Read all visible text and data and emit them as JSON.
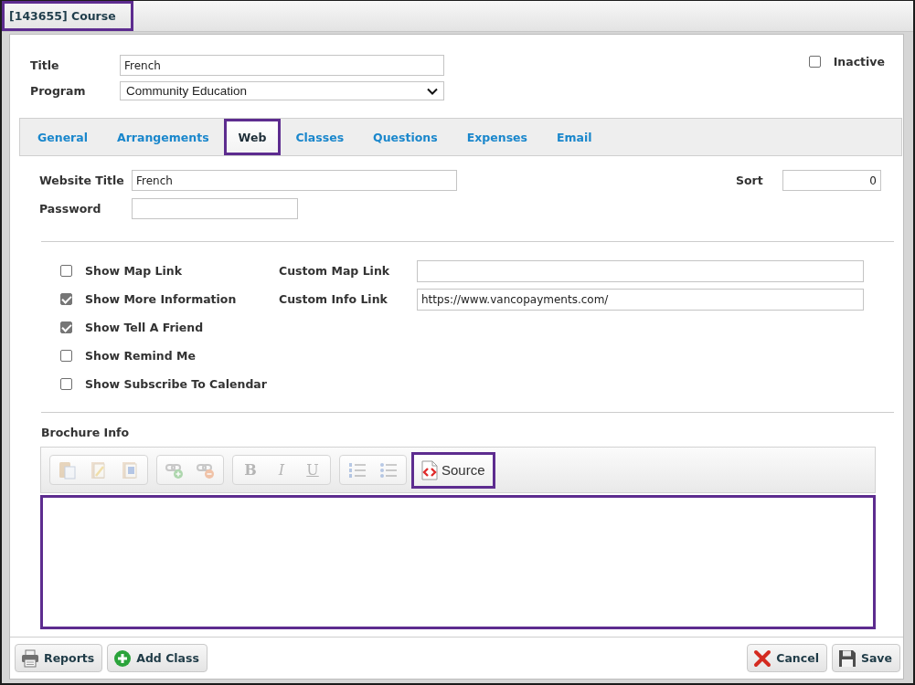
{
  "window": {
    "title": "[143655] Course",
    "highlighted": true
  },
  "form": {
    "fields": [
      {
        "kind": "text",
        "label": "Title",
        "value": "French"
      },
      {
        "kind": "select",
        "label": "Program",
        "value": "Community Education"
      }
    ],
    "inactive": {
      "label": "Inactive",
      "checked": false
    }
  },
  "tabs": [
    {
      "label": "General",
      "selected": false,
      "highlighted": false
    },
    {
      "label": "Arrangements",
      "selected": false,
      "highlighted": false
    },
    {
      "label": "Web",
      "selected": true,
      "highlighted": true
    },
    {
      "label": "Classes",
      "selected": false,
      "highlighted": false
    },
    {
      "label": "Questions",
      "selected": false,
      "highlighted": false
    },
    {
      "label": "Expenses",
      "selected": false,
      "highlighted": false
    },
    {
      "label": "Email",
      "selected": false,
      "highlighted": false
    }
  ],
  "web": {
    "website_title": {
      "label": "Website Title",
      "value": "French"
    },
    "sort": {
      "label": "Sort",
      "value": "0"
    },
    "password": {
      "label": "Password"
    },
    "options": [
      {
        "label": "Show Map Link",
        "checked": false
      },
      {
        "label": "Show More Information",
        "checked": true
      },
      {
        "label": "Show Tell A Friend",
        "checked": true
      },
      {
        "label": "Show Remind Me",
        "checked": false
      },
      {
        "label": "Show Subscribe To Calendar",
        "checked": false
      }
    ],
    "custom_links": [
      {
        "label": "Custom Map Link"
      },
      {
        "label": "Custom Info Link",
        "value": "https://www.vancopayments.com/"
      }
    ],
    "brochure": {
      "label": "Brochure Info",
      "toolbar_groups": [
        {
          "buttons": [
            {
              "kind": "paste",
              "disabled": true
            },
            {
              "kind": "paste-text",
              "disabled": true
            },
            {
              "kind": "paste-word",
              "disabled": true
            }
          ]
        },
        {
          "buttons": [
            {
              "kind": "link",
              "disabled": true
            },
            {
              "kind": "unlink",
              "disabled": true
            }
          ]
        },
        {
          "buttons": [
            {
              "kind": "bold",
              "glyph": "B",
              "disabled": true
            },
            {
              "kind": "italic",
              "glyph": "I",
              "disabled": true
            },
            {
              "kind": "underline",
              "glyph": "U",
              "disabled": true
            }
          ]
        },
        {
          "buttons": [
            {
              "kind": "numbered-list",
              "disabled": true
            },
            {
              "kind": "bulleted-list",
              "disabled": true
            }
          ]
        }
      ],
      "source_button": {
        "label": "Source",
        "highlighted": true
      },
      "body": {
        "highlighted": true
      }
    }
  },
  "footer": {
    "left_buttons": [
      {
        "kind": "print",
        "label": "Reports"
      },
      {
        "kind": "add",
        "label": "Add Class"
      }
    ],
    "right_buttons": [
      {
        "kind": "cancel",
        "label": "Cancel"
      },
      {
        "kind": "save",
        "label": "Save"
      }
    ]
  }
}
